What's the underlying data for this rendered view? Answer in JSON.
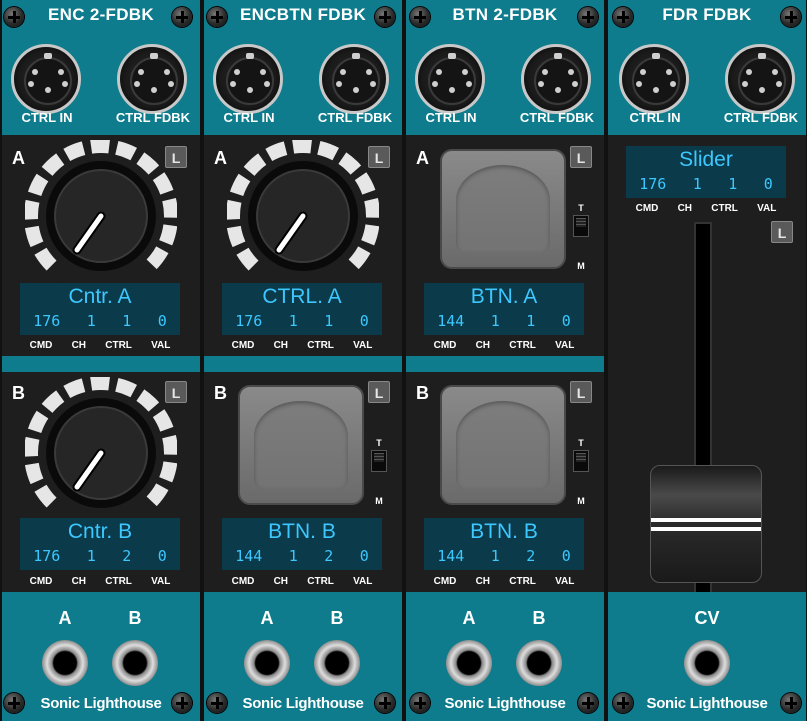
{
  "modules": [
    {
      "title": "ENC 2-FDBK",
      "ctrl_in": "CTRL IN",
      "ctrl_fdbk": "CTRL FDBK",
      "a": {
        "label": "A",
        "l": "L",
        "name": "Cntr. A",
        "cmd": "176",
        "ch": "1",
        "ctrl": "1",
        "val": "0"
      },
      "b": {
        "label": "B",
        "l": "L",
        "name": "Cntr. B",
        "cmd": "176",
        "ch": "1",
        "ctrl": "2",
        "val": "0"
      },
      "jacks": [
        "A",
        "B"
      ],
      "brand": "Sonic Lighthouse"
    },
    {
      "title": "ENCBTN FDBK",
      "ctrl_in": "CTRL IN",
      "ctrl_fdbk": "CTRL FDBK",
      "a": {
        "label": "A",
        "l": "L",
        "name": "CTRL. A",
        "cmd": "176",
        "ch": "1",
        "ctrl": "1",
        "val": "0"
      },
      "b": {
        "label": "B",
        "l": "L",
        "name": "BTN. B",
        "cmd": "144",
        "ch": "1",
        "ctrl": "2",
        "val": "0",
        "sw_t": "T",
        "sw_m": "M"
      },
      "jacks": [
        "A",
        "B"
      ],
      "brand": "Sonic Lighthouse"
    },
    {
      "title": "BTN 2-FDBK",
      "ctrl_in": "CTRL IN",
      "ctrl_fdbk": "CTRL FDBK",
      "a": {
        "label": "A",
        "l": "L",
        "name": "BTN. A",
        "cmd": "144",
        "ch": "1",
        "ctrl": "1",
        "val": "0",
        "sw_t": "T",
        "sw_m": "M"
      },
      "b": {
        "label": "B",
        "l": "L",
        "name": "BTN. B",
        "cmd": "144",
        "ch": "1",
        "ctrl": "2",
        "val": "0",
        "sw_t": "T",
        "sw_m": "M"
      },
      "jacks": [
        "A",
        "B"
      ],
      "brand": "Sonic Lighthouse"
    },
    {
      "title": "FDR FDBK",
      "ctrl_in": "CTRL IN",
      "ctrl_fdbk": "CTRL FDBK",
      "slider": {
        "l": "L",
        "name": "Slider",
        "cmd": "176",
        "ch": "1",
        "ctrl": "1",
        "val": "0"
      },
      "jacks": [
        "CV"
      ],
      "brand": "Sonic Lighthouse"
    }
  ],
  "captions": {
    "cmd": "CMD",
    "ch": "CH",
    "ctrl": "CTRL",
    "val": "VAL"
  },
  "colors": {
    "panel": "#0e7c8c",
    "display_bg": "#0b3a4a",
    "display_text": "#3cc8ff",
    "body": "#1e1e1e"
  },
  "icons": {
    "screw": "screw-icon",
    "midi": "midi-din-port-icon",
    "jack": "audio-jack-icon"
  }
}
